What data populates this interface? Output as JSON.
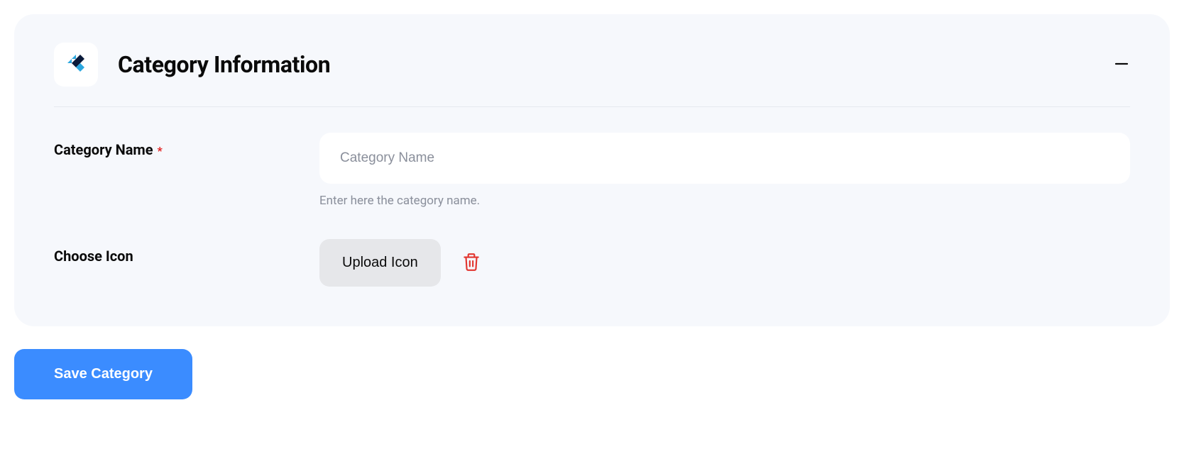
{
  "card": {
    "title": "Category Information",
    "fields": {
      "category_name": {
        "label": "Category Name",
        "required_marker": "*",
        "placeholder": "Category Name",
        "value": "",
        "help": "Enter here the category name."
      },
      "choose_icon": {
        "label": "Choose Icon",
        "upload_button": "Upload Icon"
      }
    }
  },
  "actions": {
    "save": "Save Category"
  }
}
